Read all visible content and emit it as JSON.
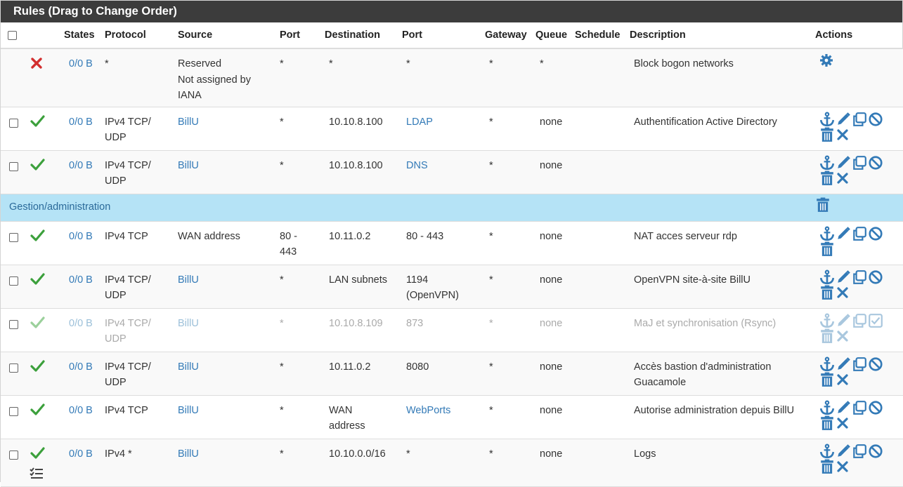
{
  "panel": {
    "title": "Rules (Drag to Change Order)"
  },
  "columns": {
    "states": "States",
    "protocol": "Protocol",
    "source": "Source",
    "port": "Port",
    "destination": "Destination",
    "dport": "Port",
    "gateway": "Gateway",
    "queue": "Queue",
    "schedule": "Schedule",
    "description": "Description",
    "actions": "Actions"
  },
  "colors": {
    "heading": "#3c3c3c",
    "link": "#337ab7",
    "pass": "#3ca03c",
    "block": "#d32f2f",
    "separator": "#b5e3f6"
  },
  "rows": [
    {
      "status": "block",
      "states": "0/0 B",
      "protocol": "*",
      "source": "Reserved\nNot assigned by IANA",
      "port": "*",
      "destination": "*",
      "dport": "*",
      "gateway": "*",
      "queue": "*",
      "schedule": "",
      "description": "Block bogon networks",
      "actions": "settings"
    },
    {
      "status": "pass",
      "states": "0/0 B",
      "protocol": "IPv4 TCP/\nUDP",
      "source": "BillU",
      "port": "*",
      "destination": "10.10.8.100",
      "dport": "LDAP",
      "gateway": "*",
      "queue": "none",
      "schedule": "",
      "description": "Authentification Active Directory"
    },
    {
      "status": "pass",
      "states": "0/0 B",
      "protocol": "IPv4 TCP/\nUDP",
      "source": "BillU",
      "port": "*",
      "destination": "10.10.8.100",
      "dport": "DNS",
      "gateway": "*",
      "queue": "none",
      "schedule": "",
      "description": ""
    },
    {
      "separator": "Gestion/administration"
    },
    {
      "status": "pass",
      "states": "0/0 B",
      "protocol": "IPv4 TCP",
      "source": "WAN address",
      "port": "80 -\n443",
      "destination": "10.11.0.2",
      "dport": "80 - 443",
      "gateway": "*",
      "queue": "none",
      "schedule": "",
      "description": "NAT acces serveur rdp"
    },
    {
      "status": "pass",
      "states": "0/0 B",
      "protocol": "IPv4 TCP/\nUDP",
      "source": "BillU",
      "port": "*",
      "destination": "LAN subnets",
      "dport": "1194\n(OpenVPN)",
      "gateway": "*",
      "queue": "none",
      "schedule": "",
      "description": "OpenVPN site-à-site BillU"
    },
    {
      "status": "pass",
      "disabled": true,
      "states": "0/0 B",
      "protocol": "IPv4 TCP/\nUDP",
      "source": "BillU",
      "port": "*",
      "destination": "10.10.8.109",
      "dport": "873",
      "gateway": "*",
      "queue": "none",
      "schedule": "",
      "description": "MaJ et synchronisation (Rsync)"
    },
    {
      "status": "pass",
      "states": "0/0 B",
      "protocol": "IPv4 TCP/\nUDP",
      "source": "BillU",
      "port": "*",
      "destination": "10.11.0.2",
      "dport": "8080",
      "gateway": "*",
      "queue": "none",
      "schedule": "",
      "description": "Accès bastion d'administration Guacamole"
    },
    {
      "status": "pass",
      "states": "0/0 B",
      "protocol": "IPv4 TCP",
      "source": "BillU",
      "port": "*",
      "destination": "WAN\naddress",
      "dport": "WebPorts",
      "gateway": "*",
      "queue": "none",
      "schedule": "",
      "description": "Autorise administration depuis BillU"
    },
    {
      "status": "pass",
      "log": true,
      "states": "0/0 B",
      "protocol": "IPv4 *",
      "source": "BillU",
      "port": "*",
      "destination": "10.10.0.0/16",
      "dport": "*",
      "gateway": "*",
      "queue": "none",
      "schedule": "",
      "description": "Logs"
    }
  ]
}
